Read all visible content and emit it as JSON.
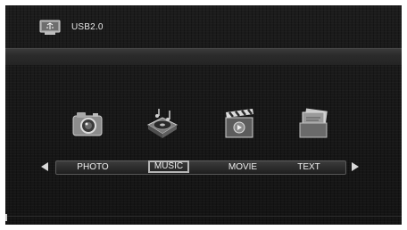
{
  "header": {
    "device_label": "USB2.0",
    "device_icon": "usb-drive-icon"
  },
  "menu": {
    "items": [
      {
        "label": "PHOTO",
        "icon": "camera-icon",
        "selected": false
      },
      {
        "label": "MUSIC",
        "icon": "music-player-icon",
        "selected": true
      },
      {
        "label": "MOVIE",
        "icon": "clapperboard-icon",
        "selected": false
      },
      {
        "label": "TEXT",
        "icon": "text-document-icon",
        "selected": false
      }
    ],
    "left_arrow": "arrow-left-icon",
    "right_arrow": "arrow-right-icon"
  },
  "colors": {
    "background": "#161616",
    "text": "#efefef",
    "selection_border": "#b5b5b5"
  }
}
